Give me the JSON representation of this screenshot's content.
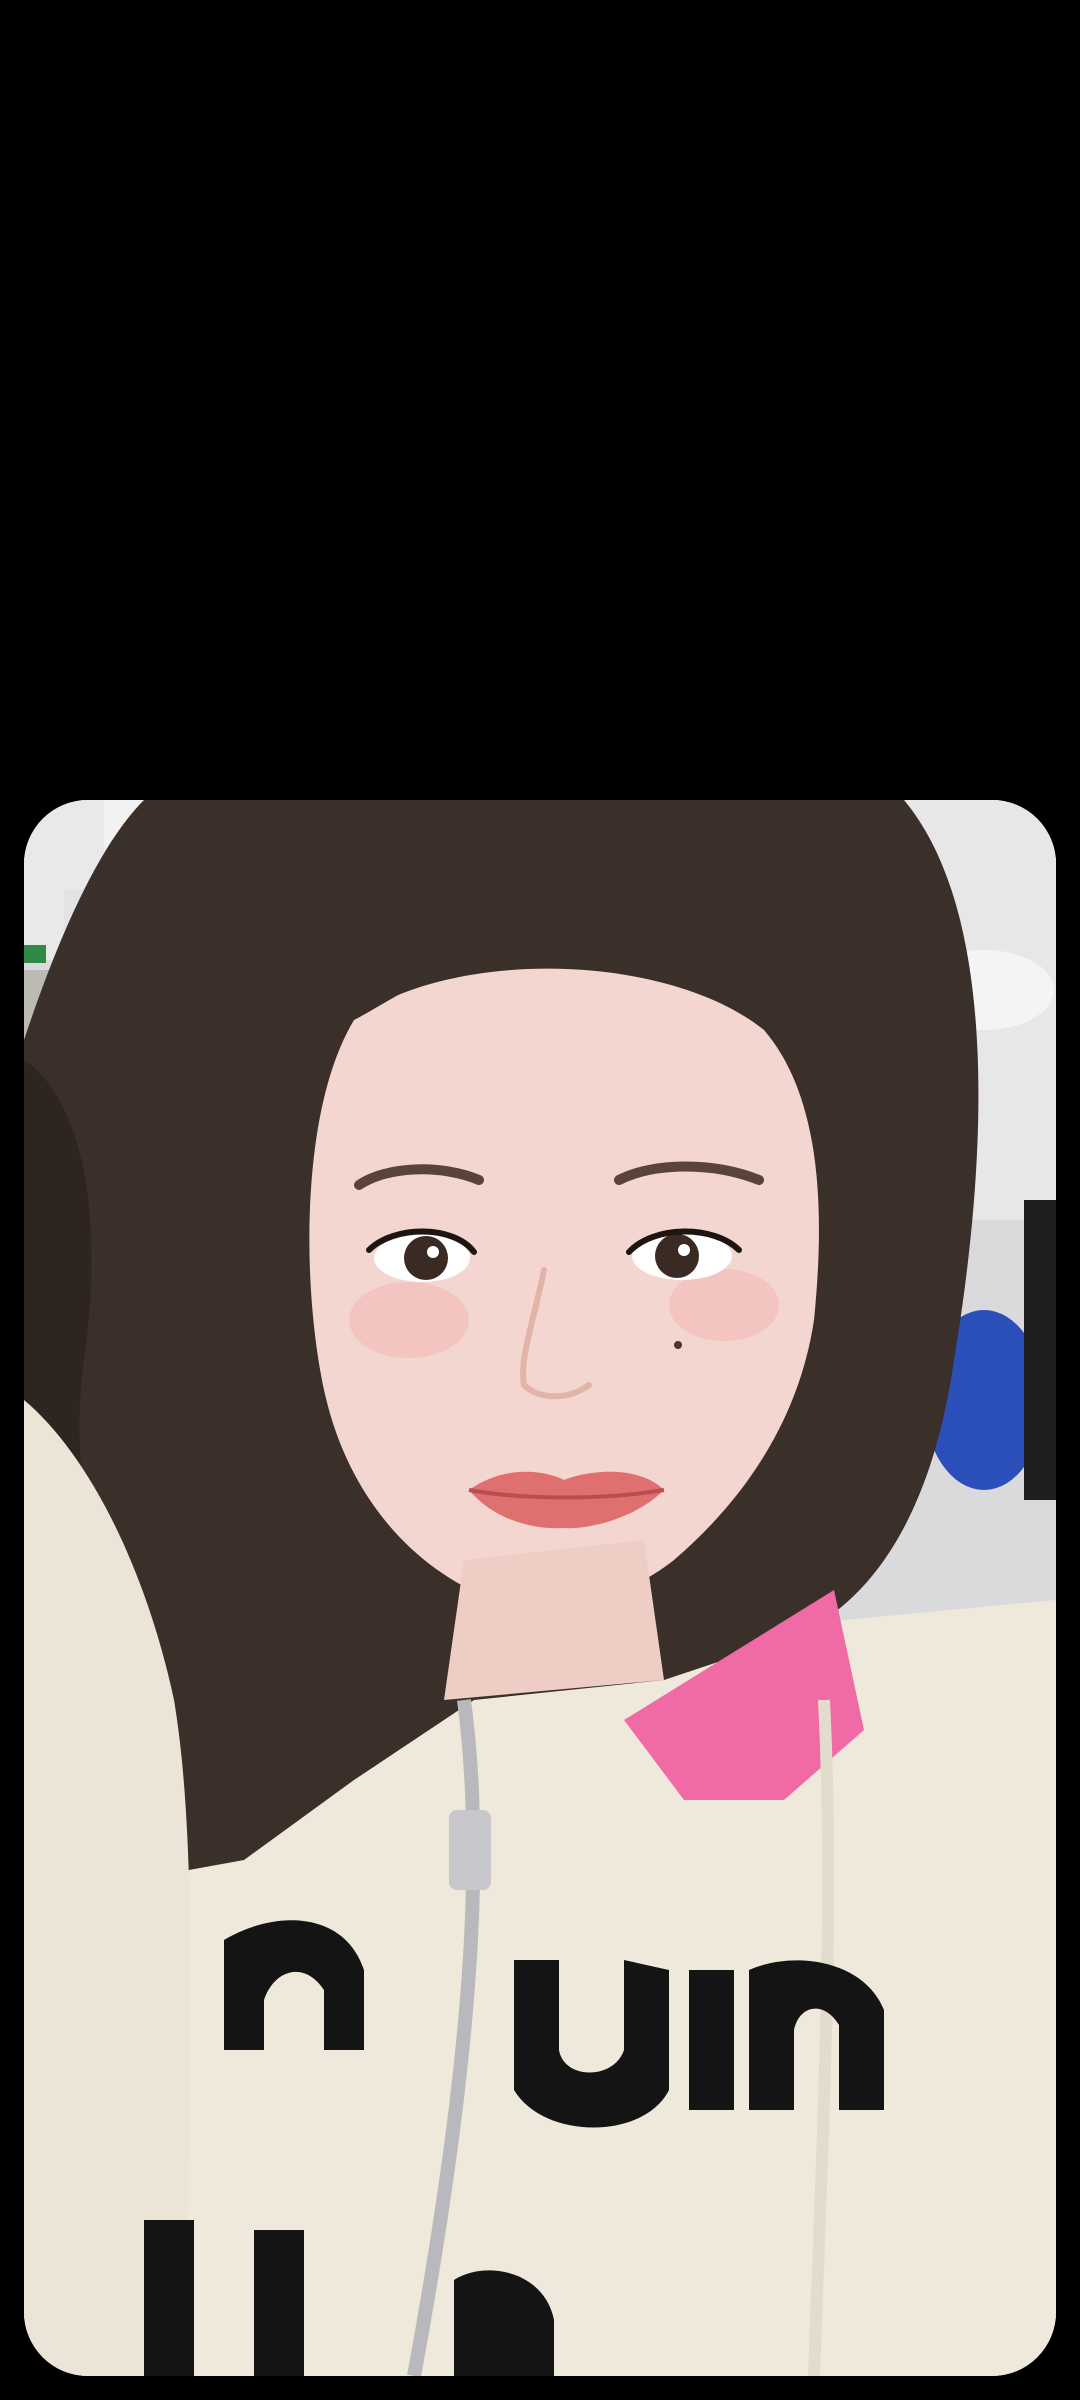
{
  "viewer": {
    "background_color": "#000000",
    "photo_subject": "selfie-portrait",
    "photo_colors": {
      "background": "#d9d9db",
      "hair": "#3b2f2a",
      "skin": "#f3d6cf",
      "sweater": "#efe9dc",
      "collar": "#f06aa6",
      "print": "#111111",
      "chair": "#2a4fb8"
    }
  }
}
